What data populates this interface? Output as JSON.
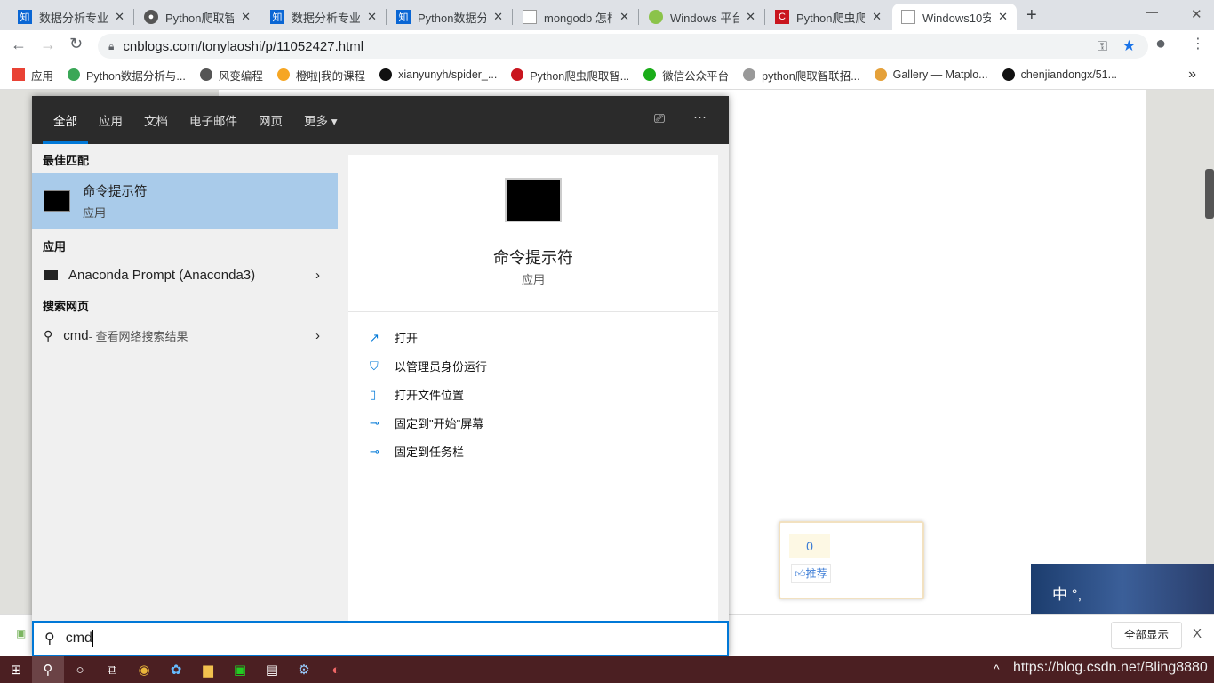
{
  "browser": {
    "tabs": [
      {
        "title": "数据分析专业课",
        "icon": "zhihu-icon",
        "color": "#0a66d4",
        "glyph": "知"
      },
      {
        "title": "Python爬取智联",
        "icon": "globe-icon",
        "color": "#555",
        "glyph": "●"
      },
      {
        "title": "数据分析专业课",
        "icon": "zhihu-icon",
        "color": "#0a66d4",
        "glyph": "知"
      },
      {
        "title": "Python数据分析",
        "icon": "zhihu-icon",
        "color": "#0a66d4",
        "glyph": "知"
      },
      {
        "title": "mongodb 怎样",
        "icon": "cnblogs-icon",
        "color": "#fff",
        "glyph": ""
      },
      {
        "title": "Windows 平台",
        "icon": "android-icon",
        "color": "#8bc34a",
        "glyph": ""
      },
      {
        "title": "Python爬虫爬",
        "icon": "csdn-icon",
        "color": "#c9151e",
        "glyph": "C"
      },
      {
        "title": "Windows10安",
        "icon": "cnblogs-icon",
        "color": "#fff",
        "glyph": ""
      }
    ],
    "new_tab": "+",
    "url": "cnblogs.com/tonylaoshi/p/11052427.html",
    "bookmarks": [
      {
        "label": "应用",
        "color": "#e94235"
      },
      {
        "label": "Python数据分析与...",
        "color": "#3aa757"
      },
      {
        "label": "风变编程",
        "color": "#555"
      },
      {
        "label": "橙啦|我的课程",
        "color": "#f6a623"
      },
      {
        "label": "xianyunyh/spider_...",
        "color": "#111"
      },
      {
        "label": "Python爬虫爬取智...",
        "color": "#c9151e"
      },
      {
        "label": "微信公众平台",
        "color": "#1aad19"
      },
      {
        "label": "python爬取智联招...",
        "color": "#999"
      },
      {
        "label": "Gallery — Matplo...",
        "color": "#e5a13a"
      },
      {
        "label": "chenjiandongx/51...",
        "color": "#111"
      }
    ],
    "more": "»"
  },
  "page": {
    "recommend_count": "0",
    "recommend_label": "推荐",
    "ime": "中 °,",
    "show_all": "全部显示",
    "close": "X"
  },
  "start": {
    "tabs": [
      "全部",
      "应用",
      "文档",
      "电子邮件",
      "网页",
      "更多 ▾"
    ],
    "best_match_header": "最佳匹配",
    "best_match": {
      "name": "命令提示符",
      "type": "应用"
    },
    "apps_header": "应用",
    "apps": [
      {
        "name": "Anaconda Prompt (Anaconda3)"
      }
    ],
    "web_header": "搜索网页",
    "web": {
      "query": "cmd",
      "hint": " - 查看网络搜索结果"
    },
    "detail": {
      "name": "命令提示符",
      "type": "应用"
    },
    "actions": [
      {
        "label": "打开",
        "icon": "open-icon"
      },
      {
        "label": "以管理员身份运行",
        "icon": "admin-shield-icon"
      },
      {
        "label": "打开文件位置",
        "icon": "file-location-icon"
      },
      {
        "label": "固定到\"开始\"屏幕",
        "icon": "pin-icon"
      },
      {
        "label": "固定到任务栏",
        "icon": "pin-icon"
      }
    ],
    "search_value": "cmd"
  },
  "watermark": "https://blog.csdn.net/Bling8880"
}
